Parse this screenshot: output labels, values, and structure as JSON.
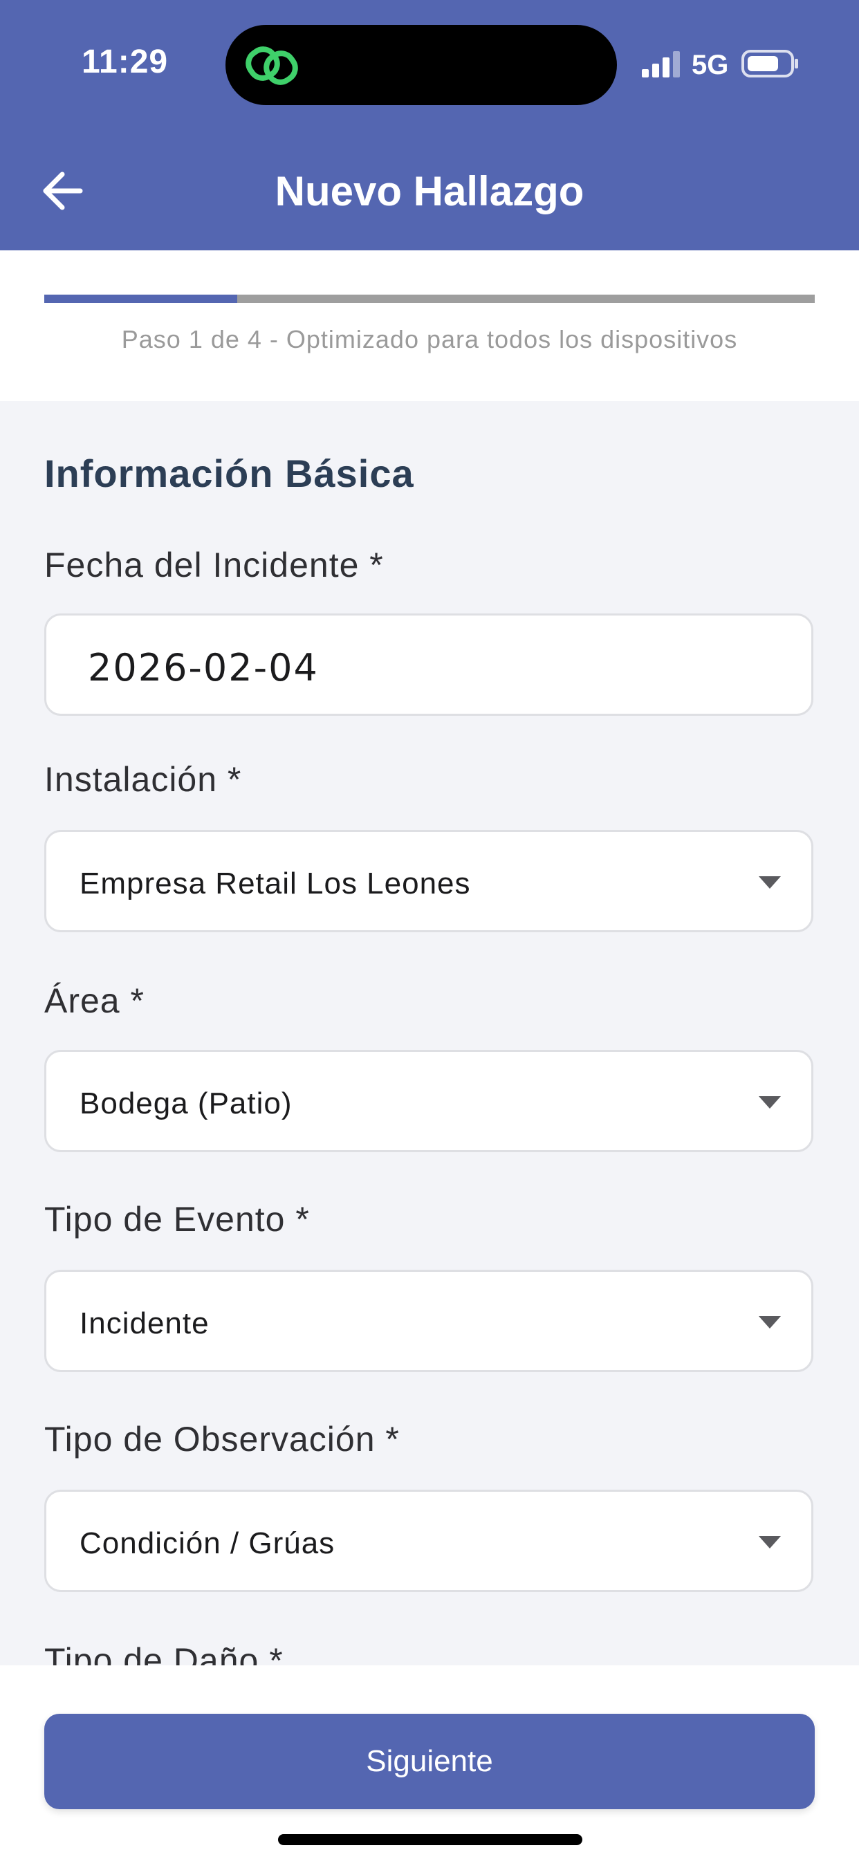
{
  "status_bar": {
    "time": "11:29",
    "network": "5G",
    "island_icon": "link-icon",
    "signal_icon": "signal-bars-icon",
    "battery_icon": "battery-icon"
  },
  "header": {
    "title": "Nuevo Hallazgo",
    "back_icon": "arrow-left-icon",
    "background_color": "#5466b1"
  },
  "progress": {
    "caption": "Paso 1 de 4 - Optimizado para todos los dispositivos",
    "current_step": 1,
    "total_steps": 4,
    "fraction": 0.25,
    "fill_color": "#5466b1",
    "track_color": "#9e9e9e"
  },
  "form": {
    "section_title": "Información Básica",
    "fields": [
      {
        "label": "Fecha del Incidente *",
        "value": "2026-02-04",
        "type": "date"
      },
      {
        "label": "Instalación *",
        "value": "Empresa Retail Los Leones",
        "type": "select"
      },
      {
        "label": "Área *",
        "value": "Bodega (Patio)",
        "type": "select"
      },
      {
        "label": "Tipo de Evento *",
        "value": "Incidente",
        "type": "select"
      },
      {
        "label": "Tipo de Observación *",
        "value": "Condición / Grúas",
        "type": "select"
      },
      {
        "label": "Tipo de Daño *",
        "type": "select"
      }
    ]
  },
  "footer": {
    "next_label": "Siguiente",
    "button_color": "#5466b1"
  }
}
